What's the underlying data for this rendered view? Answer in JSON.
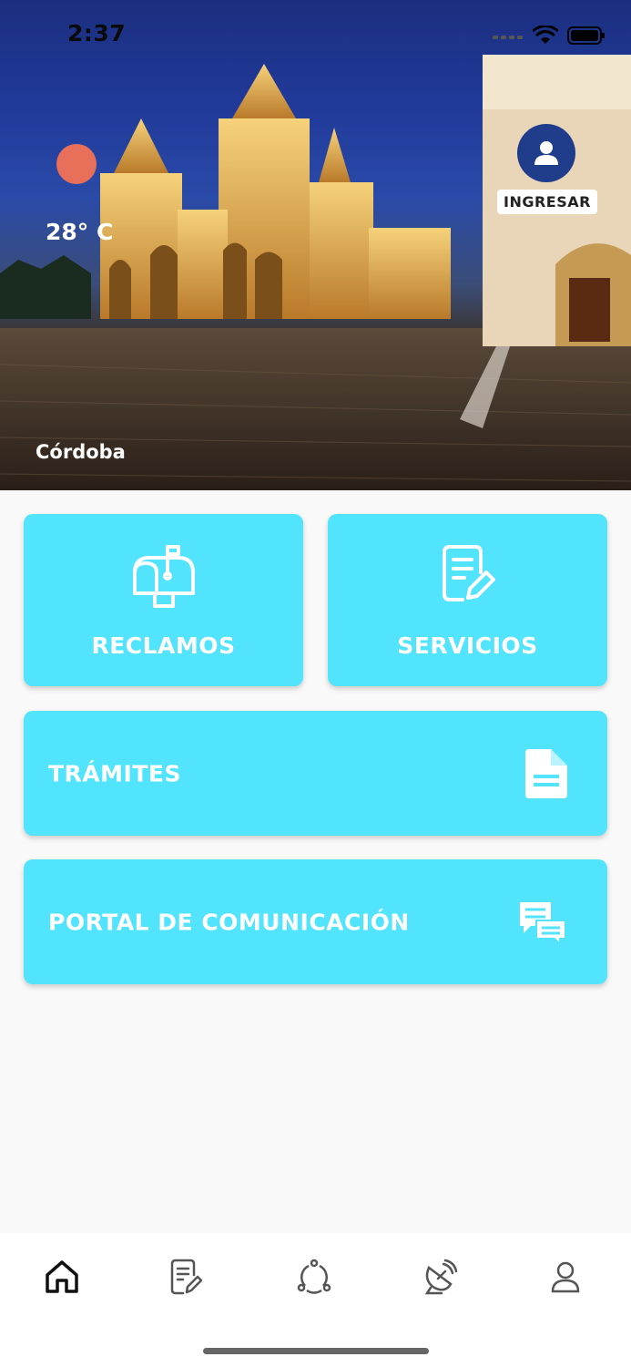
{
  "status_bar": {
    "time": "2:37"
  },
  "header": {
    "temperature": "28° C",
    "city": "Córdoba",
    "login_label": "INGRESAR",
    "weather_icon": "sun-icon"
  },
  "tiles": {
    "reclamos": {
      "label": "RECLAMOS",
      "icon": "mailbox-icon"
    },
    "servicios": {
      "label": "SERVICIOS",
      "icon": "document-edit-icon"
    },
    "tramites": {
      "label": "TRÁMITES",
      "icon": "document-icon"
    },
    "portal": {
      "label": "PORTAL DE COMUNICACIÓN",
      "icon": "chat-icon"
    }
  },
  "tabbar": {
    "items": [
      {
        "name": "home",
        "icon": "home-icon",
        "active": true
      },
      {
        "name": "servicios",
        "icon": "document-edit-icon",
        "active": false
      },
      {
        "name": "comunidad",
        "icon": "community-icon",
        "active": false
      },
      {
        "name": "antena",
        "icon": "satellite-dish-icon",
        "active": false
      },
      {
        "name": "perfil",
        "icon": "user-icon",
        "active": false
      }
    ]
  },
  "colors": {
    "tile": "#52e3fd",
    "avatar": "#1f3d8a",
    "sun": "#e8705a"
  }
}
